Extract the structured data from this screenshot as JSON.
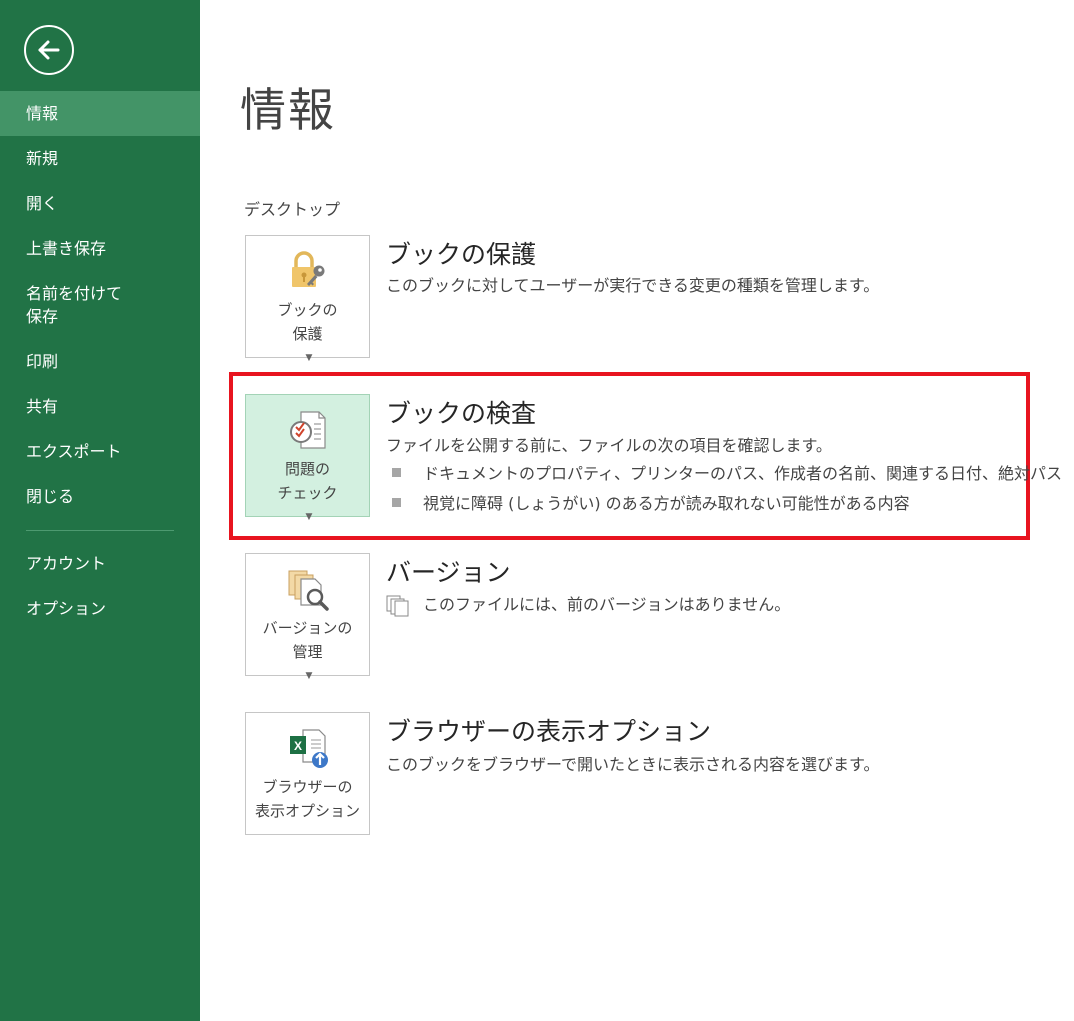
{
  "sidebar": {
    "items": [
      {
        "label": "情報"
      },
      {
        "label": "新規"
      },
      {
        "label": "開く"
      },
      {
        "label": "上書き保存"
      },
      {
        "label": "名前を付けて",
        "label2": "保存"
      },
      {
        "label": "印刷"
      },
      {
        "label": "共有"
      },
      {
        "label": "エクスポート"
      },
      {
        "label": "閉じる"
      },
      {
        "label": "アカウント"
      },
      {
        "label": "オプション"
      }
    ],
    "active_index": 0,
    "back_icon": "back-arrow-icon"
  },
  "main": {
    "title": "情報",
    "section_label": "デスクトップ",
    "features": [
      {
        "tile_line1": "ブックの",
        "tile_line2": "保護",
        "title": "ブックの保護",
        "description": "このブックに対してユーザーが実行できる変更の種類を管理します。",
        "icon": "lock-key-icon"
      },
      {
        "tile_line1": "問題の",
        "tile_line2": "チェック",
        "title": "ブックの検査",
        "description": "ファイルを公開する前に、ファイルの次の項目を確認します。",
        "bullets": [
          "ドキュメントのプロパティ、プリンターのパス、作成者の名前、関連する日付、絶対パス",
          "視覚に障碍 (しょうがい) のある方が読み取れない可能性がある内容"
        ],
        "icon": "check-document-icon"
      },
      {
        "tile_line1": "バージョンの",
        "tile_line2": "管理",
        "title": "バージョン",
        "description": "このファイルには、前のバージョンはありません。",
        "icon": "versions-search-icon"
      },
      {
        "tile_line1": "ブラウザーの",
        "tile_line2": "表示オプション",
        "title": "ブラウザーの表示オプション",
        "description": "このブックをブラウザーで開いたときに表示される内容を選びます。",
        "icon": "excel-upload-icon"
      }
    ]
  },
  "colors": {
    "sidebar_bg": "#217346",
    "sidebar_active": "#439467",
    "highlight": "#e8141f",
    "selected_tile": "#d3f0e0"
  }
}
